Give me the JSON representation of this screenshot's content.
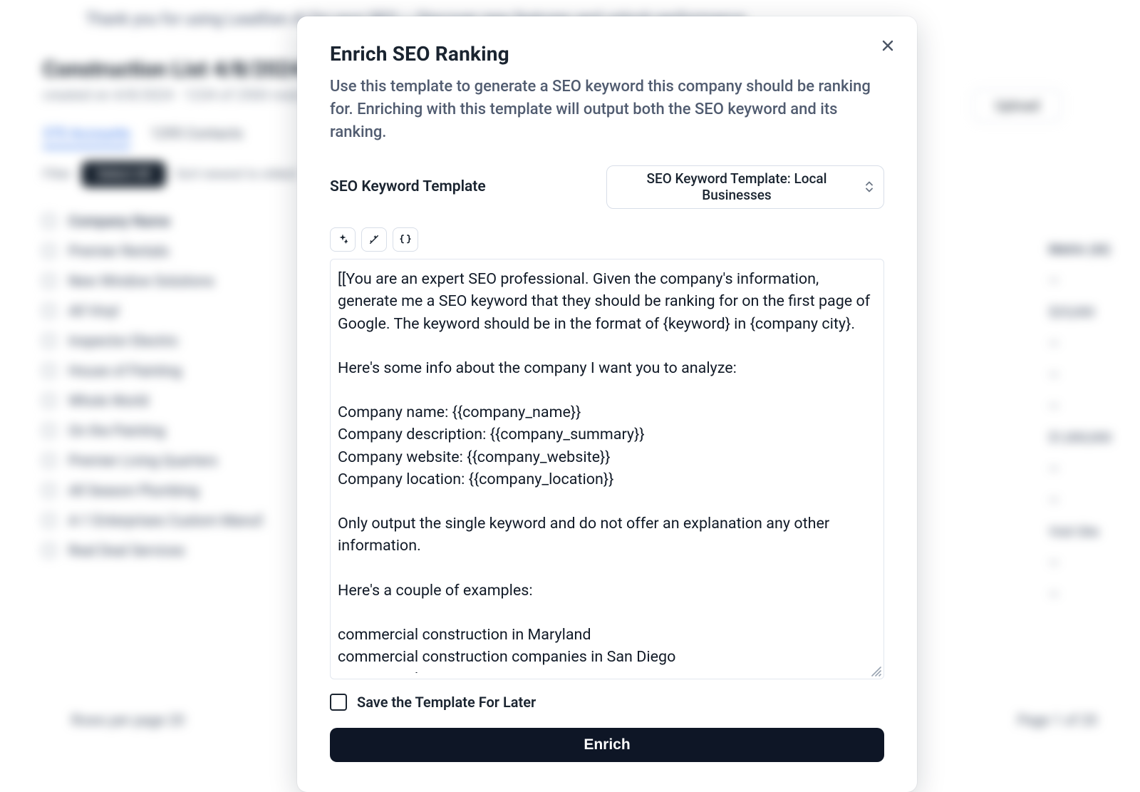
{
  "background": {
    "banner": "Thank you for using LeadGen AI for your SEO — Discover new features and unlock performance",
    "title": "Construction List 4/8/2024",
    "subtitle": "created on 4/8/2024 · 1234 of 2500 rows",
    "tabs": [
      "370 Accounts",
      "1295 Contacts"
    ],
    "filter_label": "Filter",
    "select_all": "Select All",
    "sort_label": "Sort newest to oldest",
    "header": "Company Name",
    "rows": [
      "Premier Rentals",
      "New Window Solutions",
      "All Vinyl",
      "Inspector Electric",
      "House of Painting",
      "Whole World",
      "On the Painting",
      "Premier Living Quarters",
      "All Season Plumbing",
      "A-1 Enterprises Custom Manuf.",
      "Real Deal Services"
    ],
    "right_header": "Metric (AI)",
    "right_values": [
      "—",
      "$25,000",
      "—",
      "—",
      "—",
      "$1,000,000",
      "—",
      "—",
      "Visit Site",
      "—",
      "—"
    ],
    "upload": "Upload",
    "pager_left": "Rows per page   20",
    "pager_right": "Page 1 of 20"
  },
  "modal": {
    "title": "Enrich SEO Ranking",
    "description": "Use this template to generate a SEO keyword this company should be ranking for. Enriching with this template will output both the SEO keyword and its ranking.",
    "template_label": "SEO Keyword Template",
    "template_selected": "SEO Keyword Template: Local Businesses",
    "prompt_text": "[[You are an expert SEO professional. Given the company's information, generate me a SEO keyword that they should be ranking for on the first page of Google. The keyword should be in the format of {keyword} in {company city}.\n\nHere's some info about the company I want you to analyze:\n\nCompany name: {{company_name}}\nCompany description: {{company_summary}}\nCompany website: {{company_website}}\nCompany location: {{company_location}}\n\nOnly output the single keyword and do not offer an explanation any other information.\n\nHere's a couple of examples:\n\ncommercial construction in Maryland\ncommercial construction companies in San Diego\ncommercial construction contractor in LA",
    "save_label": "Save the Template For Later",
    "submit": "Enrich"
  }
}
